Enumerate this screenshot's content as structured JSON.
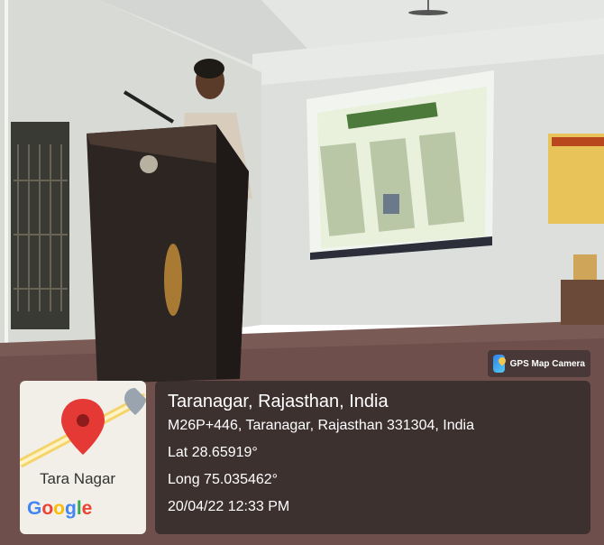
{
  "gps_badge": {
    "label": "GPS Map Camera",
    "icon": "gps-map-camera-icon"
  },
  "map": {
    "place_label": "Tara Nagar",
    "logo": [
      "G",
      "o",
      "o",
      "g",
      "l",
      "e"
    ],
    "pin_color": "#e53935"
  },
  "location": {
    "title": "Taranagar, Rajasthan, India",
    "address": "M26P+446, Taranagar, Rajasthan 331304, India",
    "lat": "Lat 28.65919°",
    "long": "Long 75.035462°",
    "datetime": "20/04/22 12:33 PM"
  }
}
